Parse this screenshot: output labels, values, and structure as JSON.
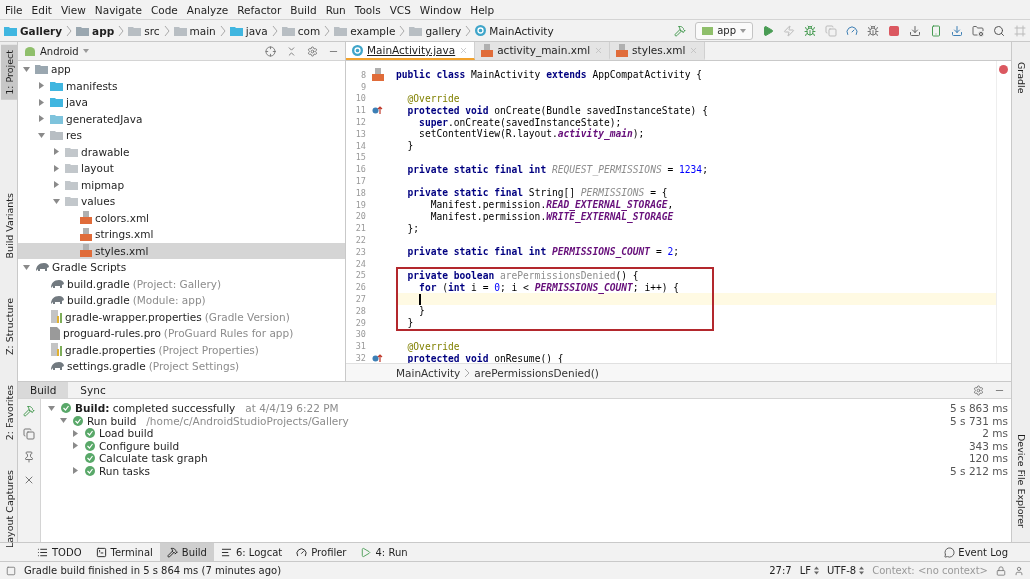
{
  "menu": [
    "File",
    "Edit",
    "View",
    "Navigate",
    "Code",
    "Analyze",
    "Refactor",
    "Build",
    "Run",
    "Tools",
    "VCS",
    "Window",
    "Help"
  ],
  "breadcrumb": [
    {
      "label": "Gallery",
      "kind": "project"
    },
    {
      "label": "app",
      "kind": "module"
    },
    {
      "label": "src",
      "kind": "folder"
    },
    {
      "label": "main",
      "kind": "folder"
    },
    {
      "label": "java",
      "kind": "source"
    },
    {
      "label": "com",
      "kind": "folder"
    },
    {
      "label": "example",
      "kind": "folder"
    },
    {
      "label": "gallery",
      "kind": "folder"
    },
    {
      "label": "MainActivity",
      "kind": "class"
    }
  ],
  "run_config": "app",
  "left_tabs": [
    {
      "label": "1: Project",
      "selected": true
    },
    {
      "label": "Build Variants",
      "selected": false
    },
    {
      "label": "Z: Structure",
      "selected": false
    },
    {
      "label": "2: Favorites",
      "selected": false
    },
    {
      "label": "Layout Captures",
      "selected": false
    }
  ],
  "right_tabs": [
    {
      "label": "Gradle"
    },
    {
      "label": "Device File Explorer"
    }
  ],
  "project": {
    "view": "Android",
    "tree": [
      {
        "name": "app",
        "kind": "module",
        "expanded": true,
        "selected": false,
        "children": [
          {
            "name": "manifests",
            "kind": "source",
            "expanded": false,
            "selected": false
          },
          {
            "name": "java",
            "kind": "source",
            "expanded": false,
            "selected": false
          },
          {
            "name": "generatedJava",
            "kind": "generated",
            "expanded": false,
            "selected": false
          },
          {
            "name": "res",
            "kind": "resources",
            "expanded": true,
            "selected": false,
            "children": [
              {
                "name": "drawable",
                "kind": "folder",
                "expanded": false,
                "selected": false
              },
              {
                "name": "layout",
                "kind": "folder",
                "expanded": false,
                "selected": false
              },
              {
                "name": "mipmap",
                "kind": "folder",
                "expanded": false,
                "selected": false
              },
              {
                "name": "values",
                "kind": "folder",
                "expanded": true,
                "selected": false,
                "children": [
                  {
                    "name": "colors.xml",
                    "kind": "xml",
                    "selected": false
                  },
                  {
                    "name": "strings.xml",
                    "kind": "xml",
                    "selected": false
                  },
                  {
                    "name": "styles.xml",
                    "kind": "xml",
                    "selected": true
                  }
                ]
              }
            ]
          }
        ]
      },
      {
        "name": "Gradle Scripts",
        "kind": "gradle",
        "expanded": true,
        "selected": false,
        "children": [
          {
            "name": "build.gradle",
            "hint": "(Project: Gallery)",
            "kind": "gradle",
            "selected": false
          },
          {
            "name": "build.gradle",
            "hint": "(Module: app)",
            "kind": "gradle",
            "selected": false
          },
          {
            "name": "gradle-wrapper.properties",
            "hint": "(Gradle Version)",
            "kind": "properties",
            "selected": false
          },
          {
            "name": "proguard-rules.pro",
            "hint": "(ProGuard Rules for app)",
            "kind": "file",
            "selected": false
          },
          {
            "name": "gradle.properties",
            "hint": "(Project Properties)",
            "kind": "properties",
            "selected": false
          },
          {
            "name": "settings.gradle",
            "hint": "(Project Settings)",
            "kind": "gradle",
            "selected": false
          }
        ]
      }
    ]
  },
  "editor": {
    "tabs": [
      {
        "label": "MainActivity.java",
        "kind": "class",
        "selected": true
      },
      {
        "label": "activity_main.xml",
        "kind": "layout",
        "selected": false
      },
      {
        "label": "styles.xml",
        "kind": "xml",
        "selected": false
      }
    ],
    "blocks": [
      {
        "boxed": false,
        "lines": [
          {
            "number": "8",
            "kind": "xml-marker",
            "current": false,
            "tokens": [
              {
                "text": "public class",
                "kind": "kw"
              },
              {
                "text": " MainActivity ",
                "kind": "plain"
              },
              {
                "text": "extends",
                "kind": "kw"
              },
              {
                "text": " AppCompatActivity {",
                "kind": "plain"
              }
            ]
          },
          {
            "number": "9",
            "current": false
          },
          {
            "number": "10",
            "current": false,
            "tokens": [
              {
                "text": "  @Override",
                "kind": "anno"
              }
            ]
          },
          {
            "number": "11",
            "kind": "override-marker",
            "current": false,
            "tokens": [
              {
                "text": "  protected void",
                "kind": "kw"
              },
              {
                "text": " onCreate(Bundle savedInstanceState) {",
                "kind": "plain"
              }
            ]
          },
          {
            "number": "12",
            "current": false,
            "tokens": [
              {
                "text": "    super",
                "kind": "kw"
              },
              {
                "text": ".onCreate(savedInstanceState);",
                "kind": "plain"
              }
            ]
          },
          {
            "number": "13",
            "current": false,
            "tokens": [
              {
                "text": "    setContentView(R.layout.",
                "kind": "plain"
              },
              {
                "text": "activity_main",
                "kind": "const"
              },
              {
                "text": ");",
                "kind": "plain"
              }
            ]
          },
          {
            "number": "14",
            "current": false,
            "tokens": [
              {
                "text": "  }",
                "kind": "plain"
              }
            ]
          },
          {
            "number": "15",
            "current": false
          },
          {
            "number": "16",
            "current": false,
            "tokens": [
              {
                "text": "  private static final int ",
                "kind": "kw"
              },
              {
                "text": "REQUEST_PERMISSIONS",
                "kind": "unused"
              },
              {
                "text": " = ",
                "kind": "plain"
              },
              {
                "text": "1234",
                "kind": "num"
              },
              {
                "text": ";",
                "kind": "plain"
              }
            ]
          },
          {
            "number": "17",
            "current": false
          },
          {
            "number": "18",
            "current": false,
            "tokens": [
              {
                "text": "  private static final",
                "kind": "kw"
              },
              {
                "text": " String[] ",
                "kind": "plain"
              },
              {
                "text": "PERMISSIONS",
                "kind": "unused"
              },
              {
                "text": " = {",
                "kind": "plain"
              }
            ]
          },
          {
            "number": "19",
            "current": false,
            "tokens": [
              {
                "text": "      Manifest.permission.",
                "kind": "plain"
              },
              {
                "text": "READ_EXTERNAL_STORAGE",
                "kind": "const"
              },
              {
                "text": ",",
                "kind": "plain"
              }
            ]
          },
          {
            "number": "20",
            "current": false,
            "tokens": [
              {
                "text": "      Manifest.permission.",
                "kind": "plain"
              },
              {
                "text": "WRITE_EXTERNAL_STORAGE",
                "kind": "const"
              }
            ]
          },
          {
            "number": "21",
            "current": false,
            "tokens": [
              {
                "text": "  };",
                "kind": "plain"
              }
            ]
          },
          {
            "number": "22",
            "current": false
          },
          {
            "number": "23",
            "current": false,
            "tokens": [
              {
                "text": "  private static final int ",
                "kind": "kw"
              },
              {
                "text": "PERMISSIONS_COUNT",
                "kind": "const"
              },
              {
                "text": " = ",
                "kind": "plain"
              },
              {
                "text": "2",
                "kind": "num"
              },
              {
                "text": ";",
                "kind": "plain"
              }
            ]
          },
          {
            "number": "24",
            "current": false
          }
        ]
      },
      {
        "boxed": true,
        "lines": [
          {
            "number": "25",
            "current": false,
            "tokens": [
              {
                "text": "  private boolean ",
                "kind": "kw"
              },
              {
                "text": "arePermissionsDenied",
                "kind": "unusedmethod"
              },
              {
                "text": "() {",
                "kind": "plain"
              }
            ]
          },
          {
            "number": "26",
            "current": false,
            "tokens": [
              {
                "text": "    for",
                "kind": "kw"
              },
              {
                "text": " (",
                "kind": "plain"
              },
              {
                "text": "int",
                "kind": "kw"
              },
              {
                "text": " i = ",
                "kind": "plain"
              },
              {
                "text": "0",
                "kind": "num"
              },
              {
                "text": "; i < ",
                "kind": "plain"
              },
              {
                "text": "PERMISSIONS_COUNT",
                "kind": "const"
              },
              {
                "text": "; i++) {",
                "kind": "plain"
              }
            ]
          },
          {
            "number": "27",
            "current": true
          },
          {
            "number": "28",
            "current": false,
            "tokens": [
              {
                "text": "    }",
                "kind": "plain"
              }
            ]
          },
          {
            "number": "29",
            "current": false,
            "tokens": [
              {
                "text": "  }",
                "kind": "plain"
              }
            ]
          }
        ]
      },
      {
        "boxed": false,
        "lines": [
          {
            "number": "30",
            "current": false
          },
          {
            "number": "31",
            "current": false,
            "tokens": [
              {
                "text": "  @Override",
                "kind": "anno"
              }
            ]
          },
          {
            "number": "32",
            "kind": "override-marker",
            "current": false,
            "tokens": [
              {
                "text": "  protected void",
                "kind": "kw"
              },
              {
                "text": " onResume() {",
                "kind": "plain"
              }
            ]
          }
        ]
      }
    ],
    "breadcrumb": [
      "MainActivity",
      "arePermissionsDenied()"
    ]
  },
  "build": {
    "tabs": [
      {
        "label": "Build",
        "selected": true
      },
      {
        "label": "Sync",
        "selected": false
      }
    ],
    "rows": [
      {
        "label": "**Build:** completed successfully",
        "detail": "at 4/4/19 6:22 PM",
        "time": "5 s 863 ms",
        "expanded": true,
        "children": [
          {
            "label": "Run build",
            "detail": "/home/c/AndroidStudioProjects/Gallery",
            "time": "5 s 731 ms",
            "expanded": true,
            "children": [
              {
                "label": "Load build",
                "time": "2 ms",
                "expanded": false
              },
              {
                "label": "Configure build",
                "time": "343 ms",
                "expanded": false
              },
              {
                "label": "Calculate task graph",
                "time": "120 ms"
              },
              {
                "label": "Run tasks",
                "time": "5 s 212 ms",
                "expanded": false
              }
            ]
          }
        ]
      }
    ]
  },
  "tool_tabs": [
    {
      "label": "TODO",
      "kind": "todo",
      "selected": false
    },
    {
      "label": "Terminal",
      "kind": "terminal",
      "selected": false
    },
    {
      "label": "Build",
      "kind": "build",
      "selected": true
    },
    {
      "label": "6: Logcat",
      "kind": "logcat",
      "selected": false
    },
    {
      "label": "Profiler",
      "kind": "profiler",
      "selected": false
    },
    {
      "label": "4: Run",
      "kind": "run",
      "selected": false
    }
  ],
  "event_log": "Event Log",
  "status": {
    "message": "Gradle build finished in 5 s 864 ms (7 minutes ago)",
    "position": "27:7",
    "line_separator": "LF",
    "encoding": "UTF-8",
    "context": "Context: <no context>"
  }
}
